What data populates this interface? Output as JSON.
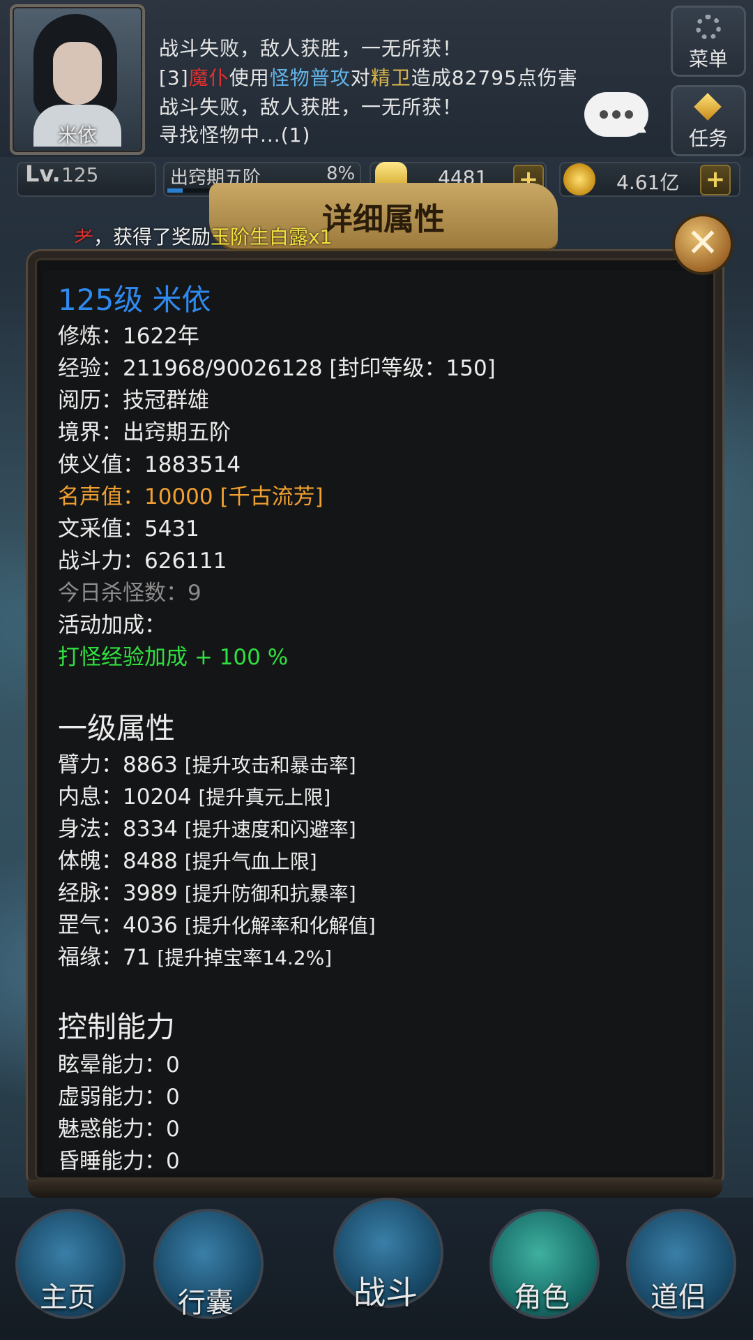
{
  "header": {
    "player_name": "米依",
    "battle_log": {
      "line_fail_1": "战斗失败，敌人获胜，一无所获！",
      "attack_prefix": "[3]",
      "attacker": "魔仆",
      "verb_use": "使用",
      "skill": "怪物普攻",
      "verb_to": "对",
      "target": "精卫",
      "damage_text": "造成82795点伤害",
      "line_fail_2": "战斗失败，敌人获胜，一无所获！",
      "line_search": "寻找怪物中...(1)"
    },
    "menu_label": "菜单",
    "task_label": "任务"
  },
  "stats_bar": {
    "lv_label": "Lv.",
    "lv_value": "125",
    "realm": "出窍期五阶",
    "realm_progress": "8%",
    "realm_progress_fraction": 0.08,
    "ingots": "4481",
    "coins": "4.61亿",
    "plus": "+"
  },
  "modal": {
    "title": "详细属性",
    "reward_prefix": "，获得了奖励",
    "reward_item": "玉阶生白露x1",
    "close_symbol": "✕",
    "heading": "125级 米依",
    "info_rows": [
      "修炼：1622年",
      "经验：211968/90026128 [封印等级：150]",
      "阅历：技冠群雄",
      "境界：出窍期五阶",
      "侠义值：1883514",
      "名声值：10000 [千古流芳]",
      "文采值：5431",
      "战斗力：626111",
      "今日杀怪数：9",
      "活动加成：",
      "打怪经验加成 + 100 %"
    ],
    "primary_title": "一级属性",
    "primary_attrs": [
      {
        "stat": "臂力：8863",
        "desc": "[提升攻击和暴击率]"
      },
      {
        "stat": "内息：10204",
        "desc": "[提升真元上限]"
      },
      {
        "stat": "身法：8334",
        "desc": "[提升速度和闪避率]"
      },
      {
        "stat": "体魄：8488",
        "desc": "[提升气血上限]"
      },
      {
        "stat": "经脉：3989",
        "desc": "[提升防御和抗暴率]"
      },
      {
        "stat": "罡气：4036",
        "desc": "[提升化解率和化解值]"
      },
      {
        "stat": "福缘：71",
        "desc": "[提升掉宝率14.2%]"
      }
    ],
    "control_title": "控制能力",
    "control_rows": [
      "眩晕能力：0",
      "虚弱能力：0",
      "魅惑能力：0",
      "昏睡能力：0"
    ]
  },
  "nav": {
    "home": "主页",
    "bag": "行囊",
    "battle": "战斗",
    "role": "角色",
    "partner": "道侣"
  },
  "colors": {
    "heading_blue": "#2f8af0",
    "fame_orange": "#f0a030",
    "bonus_green": "#30e040",
    "kill_gray": "#8c8c8c",
    "reward_yellow": "#f2e040",
    "log_red": "#e03030",
    "log_blue": "#63b4e8",
    "log_gold": "#d9b44a"
  },
  "icons": {
    "menu": "gear-icon",
    "task": "gem-icon",
    "chat": "chat-bubble-icon",
    "ingot": "ingot-icon",
    "coin": "coin-icon",
    "close": "close-icon"
  }
}
